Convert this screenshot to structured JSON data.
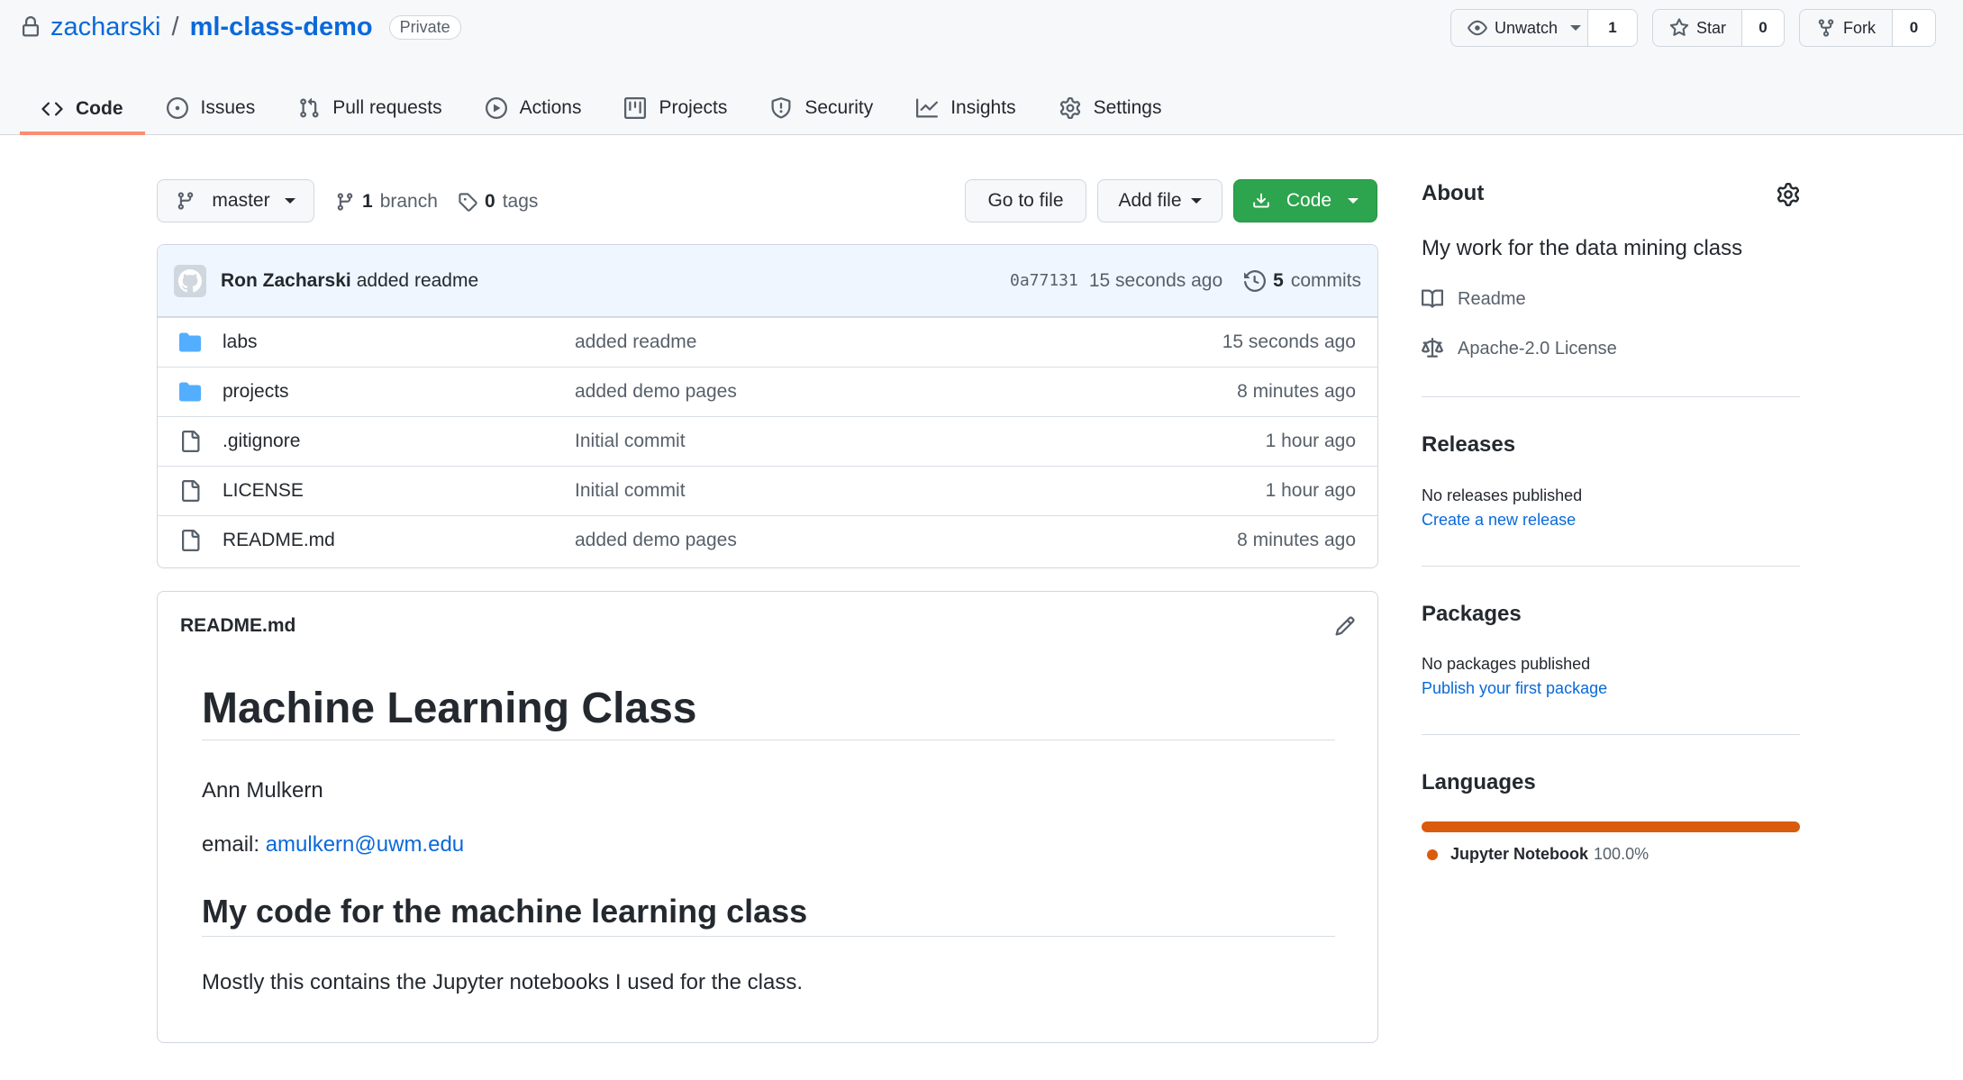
{
  "repo": {
    "owner": "zacharski",
    "separator": "/",
    "name": "ml-class-demo",
    "visibility": "Private"
  },
  "header_buttons": {
    "watch": {
      "label": "Unwatch",
      "count": "1"
    },
    "star": {
      "label": "Star",
      "count": "0"
    },
    "fork": {
      "label": "Fork",
      "count": "0"
    }
  },
  "tabs": [
    {
      "label": "Code",
      "icon": "code-icon",
      "active": true
    },
    {
      "label": "Issues",
      "icon": "issue-icon"
    },
    {
      "label": "Pull requests",
      "icon": "pull-request-icon"
    },
    {
      "label": "Actions",
      "icon": "play-icon"
    },
    {
      "label": "Projects",
      "icon": "project-icon"
    },
    {
      "label": "Security",
      "icon": "shield-icon"
    },
    {
      "label": "Insights",
      "icon": "graph-icon"
    },
    {
      "label": "Settings",
      "icon": "gear-icon"
    }
  ],
  "toolbar": {
    "branch": "master",
    "branch_count": "1",
    "branch_label": "branch",
    "tag_count": "0",
    "tag_label": "tags",
    "go_to_file": "Go to file",
    "add_file": "Add file",
    "code": "Code"
  },
  "latest_commit": {
    "author": "Ron Zacharski",
    "message": "added readme",
    "sha": "0a77131",
    "time": "15 seconds ago",
    "commit_count": "5",
    "commit_label": "commits"
  },
  "files": [
    {
      "type": "folder",
      "name": "labs",
      "message": "added readme",
      "age": "15 seconds ago"
    },
    {
      "type": "folder",
      "name": "projects",
      "message": "added demo pages",
      "age": "8 minutes ago"
    },
    {
      "type": "file",
      "name": ".gitignore",
      "message": "Initial commit",
      "age": "1 hour ago"
    },
    {
      "type": "file",
      "name": "LICENSE",
      "message": "Initial commit",
      "age": "1 hour ago"
    },
    {
      "type": "file",
      "name": "README.md",
      "message": "added demo pages",
      "age": "8 minutes ago"
    }
  ],
  "readme": {
    "filename": "README.md",
    "h1": "Machine Learning Class",
    "author": "Ann Mulkern",
    "email_label": "email: ",
    "email": "amulkern@uwm.edu",
    "h2": "My code for the machine learning class",
    "paragraph": "Mostly this contains the Jupyter notebooks I used for the class."
  },
  "about": {
    "title": "About",
    "description": "My work for the data mining class",
    "readme_label": "Readme",
    "license_label": "Apache-2.0 License"
  },
  "releases": {
    "title": "Releases",
    "status": "No releases published",
    "link": "Create a new release"
  },
  "packages": {
    "title": "Packages",
    "status": "No packages published",
    "link": "Publish your first package"
  },
  "languages": {
    "title": "Languages",
    "items": [
      {
        "name": "Jupyter Notebook",
        "percent": "100.0%",
        "color": "#DA5B0B"
      }
    ]
  }
}
